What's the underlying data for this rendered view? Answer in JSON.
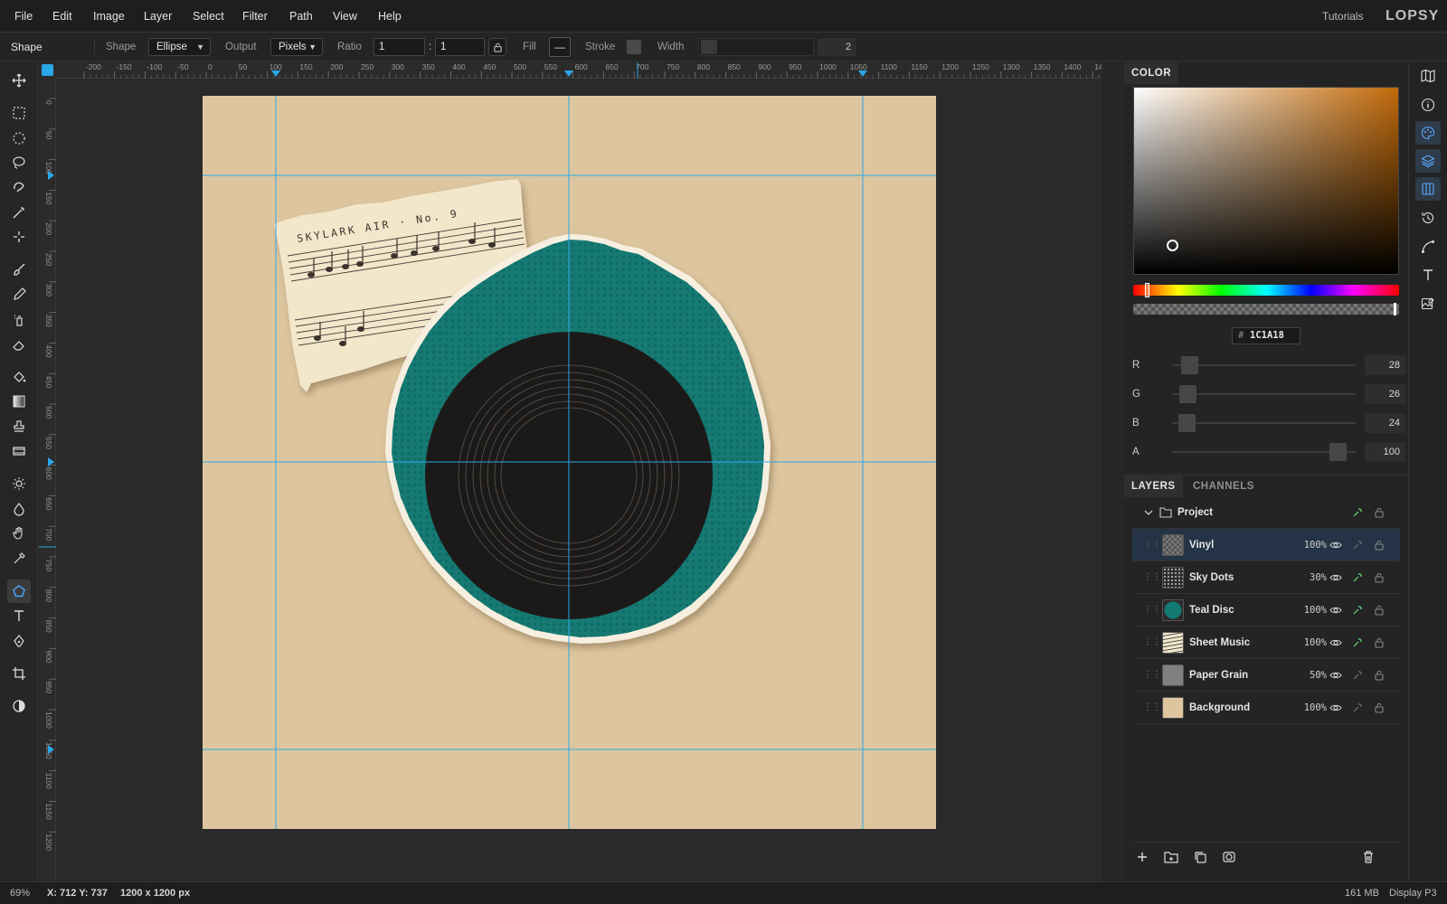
{
  "menu": [
    "File",
    "Edit",
    "Image",
    "Layer",
    "Select",
    "Filter",
    "Path",
    "View",
    "Help"
  ],
  "header": {
    "tutorials": "Tutorials",
    "logo": "LOPSY"
  },
  "options": {
    "tool_name": "Shape",
    "shape_label": "Shape",
    "shape_value": "Ellipse",
    "output_label": "Output",
    "output_value": "Pixels",
    "ratio_label": "Ratio",
    "ratio_a": "1",
    "ratio_colon": ":",
    "ratio_b": "1",
    "fill_label": "Fill",
    "fill_value": "—",
    "stroke_label": "Stroke",
    "width_label": "Width",
    "width_value": "2"
  },
  "ruler_top_labels": [
    "-200",
    "-150",
    "-100",
    "-50",
    "0",
    "50",
    "100",
    "150",
    "200",
    "250",
    "300",
    "350",
    "400",
    "450",
    "500",
    "550",
    "600",
    "650",
    "700",
    "750",
    "800",
    "850",
    "900",
    "950",
    "1000",
    "1050",
    "1100",
    "1150",
    "1200",
    "1250",
    "1300",
    "1350",
    "1400",
    "14"
  ],
  "ruler_left_labels": [
    "0",
    "50",
    "100",
    "150",
    "200",
    "250",
    "300",
    "350",
    "400",
    "450",
    "500",
    "550",
    "600",
    "650",
    "700",
    "750",
    "800",
    "850",
    "900",
    "950",
    "1000",
    "1050",
    "1100",
    "1150",
    "1200"
  ],
  "artwork": {
    "paper_title": "SKYLARK AIR · No. 9",
    "colors": {
      "background": "#ddc69f",
      "teal": "#137a73",
      "vinyl": "#1c1a18",
      "paper": "#f2e6cb",
      "guide": "#2aa8e8"
    }
  },
  "color_panel": {
    "tab": "COLOR",
    "hex_prefix": "#",
    "hex": "1C1A18",
    "channels": [
      {
        "label": "R",
        "value": "28",
        "fraction": 0.11
      },
      {
        "label": "G",
        "value": "26",
        "fraction": 0.1
      },
      {
        "label": "B",
        "value": "24",
        "fraction": 0.09
      },
      {
        "label": "A",
        "value": "100",
        "fraction": 1.0
      }
    ]
  },
  "layers_panel": {
    "tabs": [
      "LAYERS",
      "CHANNELS"
    ],
    "group": "Project",
    "layers": [
      {
        "name": "Vinyl",
        "opacity": "100%",
        "selected": true,
        "thumb": "checker"
      },
      {
        "name": "Sky Dots",
        "opacity": "30%",
        "selected": false,
        "thumb": "dots"
      },
      {
        "name": "Teal Disc",
        "opacity": "100%",
        "selected": false,
        "thumb": "teal"
      },
      {
        "name": "Sheet Music",
        "opacity": "100%",
        "selected": false,
        "thumb": "sheet"
      },
      {
        "name": "Paper Grain",
        "opacity": "50%",
        "selected": false,
        "thumb": "grey"
      },
      {
        "name": "Background",
        "opacity": "100%",
        "selected": false,
        "thumb": "tan"
      }
    ]
  },
  "status": {
    "zoom": "69%",
    "coords": "X: 712 Y: 737",
    "doc_size": "1200 x 1200 px",
    "memory": "161 MB",
    "color_profile": "Display P3"
  }
}
